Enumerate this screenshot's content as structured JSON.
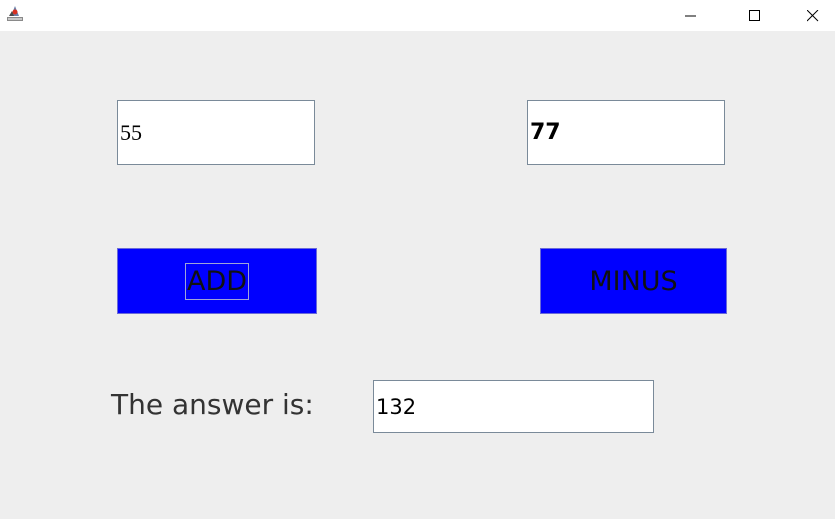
{
  "window": {
    "icon": "java-app-icon",
    "controls": {
      "minimize_icon": "minimize-icon",
      "maximize_icon": "maximize-icon",
      "close_icon": "close-icon"
    }
  },
  "inputs": {
    "first_value": "55",
    "second_value": "77"
  },
  "buttons": {
    "add_label": "ADD",
    "minus_label": "MINUS",
    "color": "#0000ff"
  },
  "result": {
    "label": "The answer is:",
    "value": "132"
  }
}
